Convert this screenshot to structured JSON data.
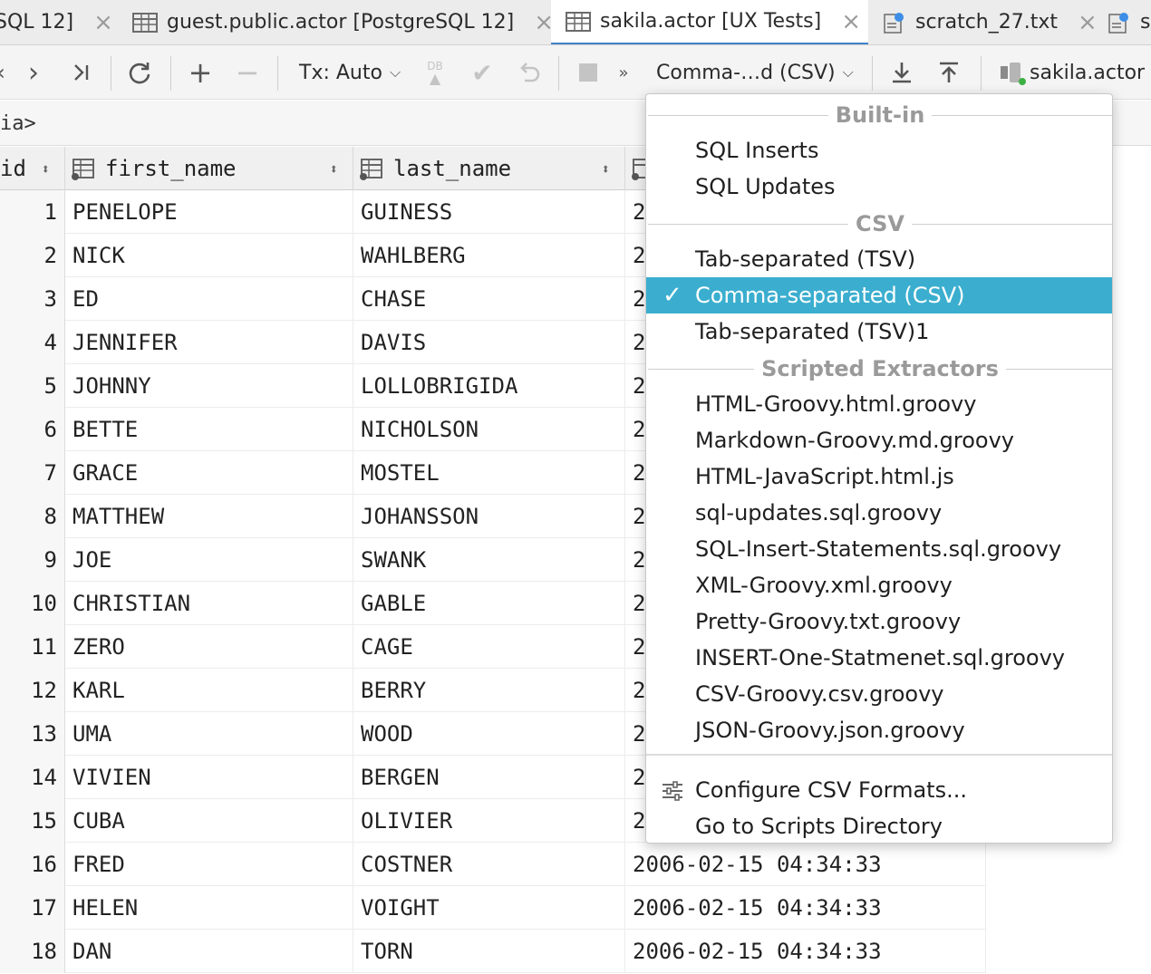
{
  "tabs": [
    {
      "label": "SQL 12]",
      "icon": "table-icon",
      "active": false,
      "has_icon": false
    },
    {
      "label": "guest.public.actor [PostgreSQL 12]",
      "icon": "table-icon",
      "active": false,
      "has_icon": true
    },
    {
      "label": "sakila.actor [UX Tests]",
      "icon": "table-icon",
      "active": true,
      "has_icon": true
    },
    {
      "label": "scratch_27.txt",
      "icon": "scratch-file-icon",
      "active": false,
      "has_icon": true
    },
    {
      "label": "s",
      "icon": "scratch-file-icon",
      "active": false,
      "has_icon": true
    }
  ],
  "toolbar": {
    "tx_mode": "Tx: Auto",
    "db_label": "DB",
    "extractor": "Comma-…d (CSV)",
    "datasource": "sakila.actor"
  },
  "filter": {
    "text": "ia>"
  },
  "grid": {
    "columns": [
      "id",
      "first_name",
      "last_name"
    ],
    "rows": [
      {
        "id": "1",
        "first_name": "PENELOPE",
        "last_name": "GUINESS",
        "last_update": "2"
      },
      {
        "id": "2",
        "first_name": "NICK",
        "last_name": "WAHLBERG",
        "last_update": "2"
      },
      {
        "id": "3",
        "first_name": "ED",
        "last_name": "CHASE",
        "last_update": "2"
      },
      {
        "id": "4",
        "first_name": "JENNIFER",
        "last_name": "DAVIS",
        "last_update": "2"
      },
      {
        "id": "5",
        "first_name": "JOHNNY",
        "last_name": "LOLLOBRIGIDA",
        "last_update": "2"
      },
      {
        "id": "6",
        "first_name": "BETTE",
        "last_name": "NICHOLSON",
        "last_update": "2"
      },
      {
        "id": "7",
        "first_name": "GRACE",
        "last_name": "MOSTEL",
        "last_update": "2"
      },
      {
        "id": "8",
        "first_name": "MATTHEW",
        "last_name": "JOHANSSON",
        "last_update": "2"
      },
      {
        "id": "9",
        "first_name": "JOE",
        "last_name": "SWANK",
        "last_update": "2"
      },
      {
        "id": "10",
        "first_name": "CHRISTIAN",
        "last_name": "GABLE",
        "last_update": "2"
      },
      {
        "id": "11",
        "first_name": "ZERO",
        "last_name": "CAGE",
        "last_update": "2"
      },
      {
        "id": "12",
        "first_name": "KARL",
        "last_name": "BERRY",
        "last_update": "2"
      },
      {
        "id": "13",
        "first_name": "UMA",
        "last_name": "WOOD",
        "last_update": "2"
      },
      {
        "id": "14",
        "first_name": "VIVIEN",
        "last_name": "BERGEN",
        "last_update": "2"
      },
      {
        "id": "15",
        "first_name": "CUBA",
        "last_name": "OLIVIER",
        "last_update": "2"
      },
      {
        "id": "16",
        "first_name": "FRED",
        "last_name": "COSTNER",
        "last_update": "2006-02-15 04:34:33"
      },
      {
        "id": "17",
        "first_name": "HELEN",
        "last_name": "VOIGHT",
        "last_update": "2006-02-15 04:34:33"
      },
      {
        "id": "18",
        "first_name": "DAN",
        "last_name": "TORN",
        "last_update": "2006-02-15 04:34:33"
      }
    ]
  },
  "dropdown": {
    "sections": [
      {
        "title": "Built-in",
        "items": [
          {
            "label": "SQL Inserts",
            "selected": false
          },
          {
            "label": "SQL Updates",
            "selected": false
          }
        ]
      },
      {
        "title": "CSV",
        "items": [
          {
            "label": "Tab-separated (TSV)",
            "selected": false
          },
          {
            "label": "Comma-separated (CSV)",
            "selected": true
          },
          {
            "label": "Tab-separated (TSV)1",
            "selected": false
          }
        ]
      },
      {
        "title": "Scripted Extractors",
        "items": [
          {
            "label": "HTML-Groovy.html.groovy",
            "selected": false
          },
          {
            "label": "Markdown-Groovy.md.groovy",
            "selected": false
          },
          {
            "label": "HTML-JavaScript.html.js",
            "selected": false
          },
          {
            "label": "sql-updates.sql.groovy",
            "selected": false
          },
          {
            "label": "SQL-Insert-Statements.sql.groovy",
            "selected": false
          },
          {
            "label": "XML-Groovy.xml.groovy",
            "selected": false
          },
          {
            "label": "Pretty-Groovy.txt.groovy",
            "selected": false
          },
          {
            "label": "INSERT-One-Statmenet.sql.groovy",
            "selected": false
          },
          {
            "label": "CSV-Groovy.csv.groovy",
            "selected": false
          },
          {
            "label": "JSON-Groovy.json.groovy",
            "selected": false
          }
        ]
      }
    ],
    "actions": [
      {
        "label": "Configure CSV Formats...",
        "icon": "sliders-icon"
      },
      {
        "label": "Go to Scripts Directory",
        "icon": ""
      }
    ],
    "check_glyph": "✓"
  },
  "colors": {
    "accent": "#3baecf",
    "tab_underline": "#4083c9",
    "status_green": "#3cb043"
  }
}
